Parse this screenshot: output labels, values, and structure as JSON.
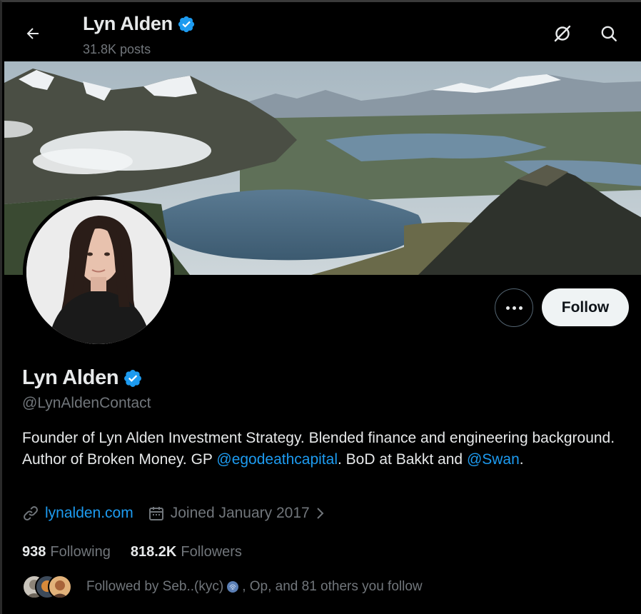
{
  "header": {
    "name": "Lyn Alden",
    "posts": "31.8K posts",
    "icons": [
      "back-arrow-icon",
      "grok-icon",
      "search-icon"
    ]
  },
  "profile": {
    "name": "Lyn Alden",
    "handle": "@LynAldenContact",
    "verified": true,
    "bio_part1": "Founder of Lyn Alden Investment Strategy. Blended finance and engineering background. Author of Broken Money. GP ",
    "bio_mention1": "@egodeathcapital",
    "bio_part2": ". BoD at Bakkt and ",
    "bio_mention2": "@Swan",
    "bio_part3": ".",
    "website": "lynalden.com",
    "joined": "Joined January 2017"
  },
  "actions": {
    "follow_label": "Follow"
  },
  "stats": {
    "following_count": "938",
    "following_label": "Following",
    "followers_count": "818.2K",
    "followers_label": "Followers"
  },
  "followed_by": {
    "prefix": "Followed by Seb..(kyc)",
    "suffix": ", Op, and 81 others you follow"
  },
  "colors": {
    "accent": "#1d9bf0",
    "background": "#000000",
    "text_primary": "#e7e9ea",
    "text_secondary": "#71767b",
    "follow_button": "#eff3f4"
  }
}
